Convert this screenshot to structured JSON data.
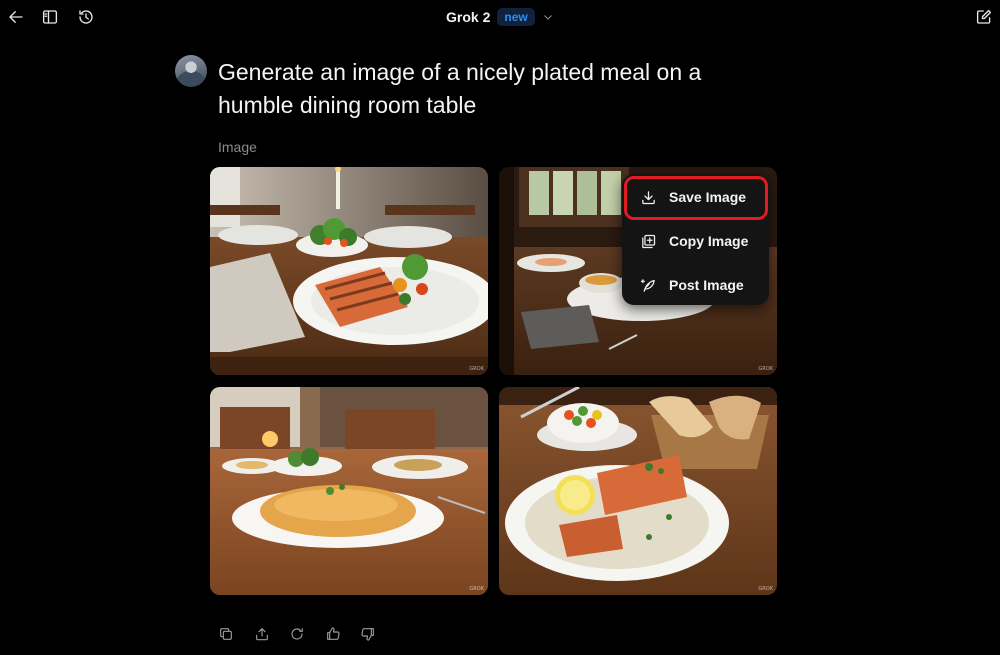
{
  "header": {
    "model_name": "Grok 2",
    "model_badge": "new",
    "icons": [
      "back-arrow-icon",
      "sidebar-toggle-icon",
      "history-icon",
      "chevron-down-icon",
      "new-chat-icon"
    ]
  },
  "message": {
    "prompt": "Generate an image of a nicely plated meal on a humble dining room table",
    "section_label": "Image"
  },
  "images": [
    {
      "watermark": "GROK"
    },
    {
      "watermark": "GROK"
    },
    {
      "watermark": "GROK"
    },
    {
      "watermark": "GROK"
    }
  ],
  "context_menu": {
    "items": [
      {
        "label": "Save Image",
        "icon": "download-icon",
        "highlighted": true
      },
      {
        "label": "Copy Image",
        "icon": "copy-image-icon"
      },
      {
        "label": "Post Image",
        "icon": "post-icon"
      }
    ],
    "highlight_color": "#e11b22"
  },
  "actions": {
    "icons": [
      "copy-icon",
      "share-icon",
      "regenerate-icon",
      "thumbs-up-icon",
      "thumbs-down-icon"
    ]
  },
  "colors": {
    "background": "#000000",
    "badge_text": "#2f8cf0",
    "badge_bg": "#10233d",
    "menu_bg": "#141414"
  }
}
